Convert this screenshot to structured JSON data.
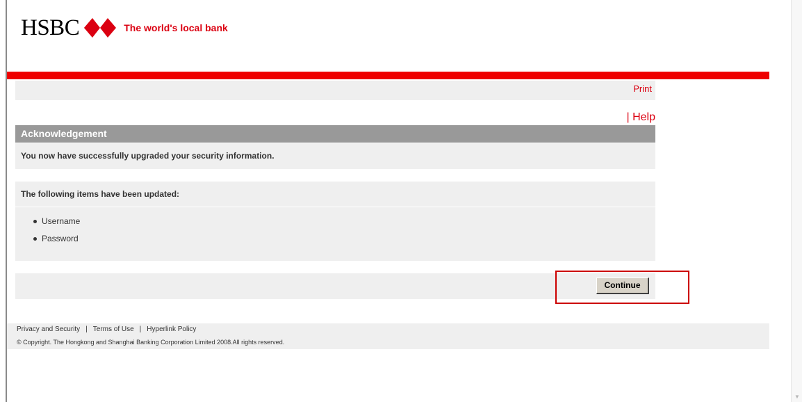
{
  "header": {
    "logo_text": "HSBC",
    "tagline": "The world's local bank"
  },
  "toolbar": {
    "print_label": "Print",
    "help_separator": "|",
    "help_label": "Help"
  },
  "acknowledgement": {
    "title": "Acknowledgement",
    "message": "You now have successfully upgraded your security information."
  },
  "updated": {
    "title": "The following items have been updated:",
    "items": [
      "Username",
      "Password"
    ]
  },
  "actions": {
    "continue_label": "Continue"
  },
  "footer": {
    "links": [
      "Privacy and Security",
      "Terms of Use",
      "Hyperlink Policy"
    ],
    "separator": "|",
    "copyright": "© Copyright. The Hongkong and Shanghai Banking Corporation Limited 2008.All rights reserved."
  },
  "colors": {
    "brand_red": "#db0011",
    "bar_red": "#ee0000",
    "header_grey": "#999999",
    "panel_grey": "#efefef",
    "highlight_red": "#cc0000"
  },
  "icons": {
    "logo": "hsbc-hexagon-icon",
    "scroll": "scroll-down-arrow-icon"
  }
}
